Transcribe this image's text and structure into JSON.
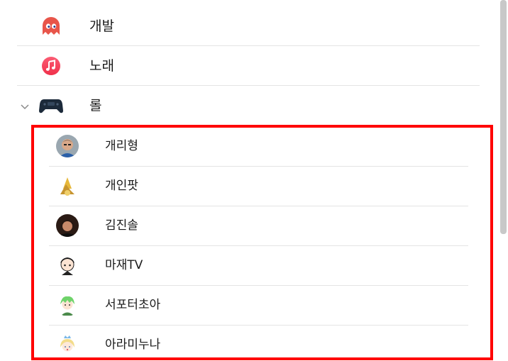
{
  "categories": [
    {
      "label": "개발",
      "icon": "ghost-icon",
      "color": "#e8554a",
      "expanded": false
    },
    {
      "label": "노래",
      "icon": "music-note-icon",
      "color": "#f23a5a",
      "expanded": false
    },
    {
      "label": "롤",
      "icon": "gamepad-icon",
      "color": "#1c2a3a",
      "expanded": true
    }
  ],
  "children": [
    {
      "label": "개리형",
      "icon": "avatar-icon"
    },
    {
      "label": "개인팟",
      "icon": "avatar-icon"
    },
    {
      "label": "김진솔",
      "icon": "avatar-icon"
    },
    {
      "label": "마재TV",
      "icon": "avatar-icon"
    },
    {
      "label": "서포터초아",
      "icon": "avatar-icon"
    },
    {
      "label": "아라미누나",
      "icon": "avatar-icon"
    }
  ],
  "highlight_color": "#ff0000"
}
